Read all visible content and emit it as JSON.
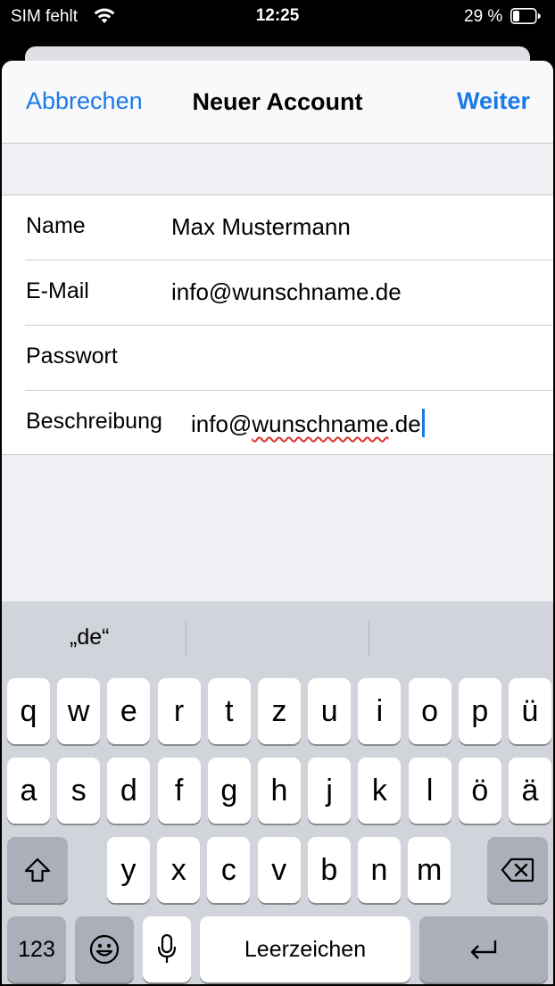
{
  "status_bar": {
    "carrier": "SIM fehlt",
    "time": "12:25",
    "battery_pct": "29 %",
    "wifi_icon": "wifi-icon",
    "battery_icon": "battery-icon"
  },
  "nav": {
    "cancel_label": "Abbrechen",
    "title": "Neuer Account",
    "next_label": "Weiter"
  },
  "form": {
    "name_label": "Name",
    "name_value": "Max Mustermann",
    "email_label": "E-Mail",
    "email_value": "info@wunschname.de",
    "password_label": "Passwort",
    "password_value": "",
    "description_label": "Beschreibung",
    "description_value_pre": "info@",
    "description_value_misspelled": "wunschname",
    "description_value_post": ".de"
  },
  "keyboard": {
    "suggestions": [
      "„de“",
      "",
      ""
    ],
    "row1": [
      "q",
      "w",
      "e",
      "r",
      "t",
      "z",
      "u",
      "i",
      "o",
      "p",
      "ü"
    ],
    "row2": [
      "a",
      "s",
      "d",
      "f",
      "g",
      "h",
      "j",
      "k",
      "l",
      "ö",
      "ä"
    ],
    "row3": [
      "y",
      "x",
      "c",
      "v",
      "b",
      "n",
      "m"
    ],
    "numbers_label": "123",
    "space_label": "Leerzeichen",
    "shift_icon": "shift-icon",
    "backspace_icon": "backspace-icon",
    "emoji_icon": "emoji-icon",
    "mic_icon": "microphone-icon",
    "return_icon": "return-icon"
  },
  "colors": {
    "accent": "#1a7ae6",
    "keyboard_bg": "#d2d4db",
    "key_dark": "#abafb9",
    "spellcheck": "#e0302b"
  }
}
